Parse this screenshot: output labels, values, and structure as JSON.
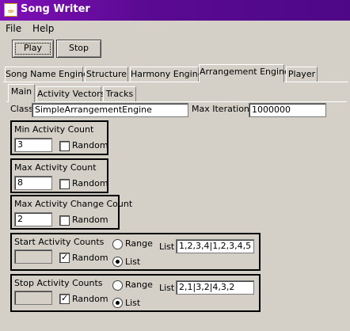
{
  "window": {
    "title": "Song Writer"
  },
  "menu": {
    "file": "File",
    "help": "Help"
  },
  "toolbar": {
    "play_label": "Play",
    "stop_label": "Stop"
  },
  "tabs": [
    "Song Name Engine",
    "Structure",
    "Harmony Engine",
    "Arrangement Engine",
    "Player"
  ],
  "selected_tab": "Arrangement Engine",
  "subtabs": [
    "Main",
    "Activity Vectors",
    "Tracks"
  ],
  "selected_subtab": "Main",
  "main": {
    "class_label": "Class",
    "class_value": "SimpleArrangementEngine",
    "max_iter_label": "Max Iterations",
    "max_iter_value": "1000000",
    "min_activity": {
      "title": "Min Activity Count",
      "value": "3",
      "random_label": "Random",
      "random_checked": false
    },
    "max_activity": {
      "title": "Max Activity Count",
      "value": "8",
      "random_label": "Random",
      "random_checked": false
    },
    "max_change": {
      "title": "Max Activity Change Count",
      "value": "2",
      "random_label": "Random",
      "random_checked": false
    },
    "start_counts": {
      "title": "Start Activity Counts",
      "value": "",
      "random_label": "Random",
      "random_checked": true,
      "range_label": "Range",
      "list_radio_label": "List",
      "selected": "List",
      "list_label": "List",
      "list_value": "1,2,3,4|1,2,3,4,5"
    },
    "stop_counts": {
      "title": "Stop Activity Counts",
      "value": "",
      "random_label": "Random",
      "random_checked": true,
      "range_label": "Range",
      "list_radio_label": "List",
      "selected": "List",
      "list_label": "List",
      "list_value": "2,1|3,2|4,3,2"
    }
  }
}
